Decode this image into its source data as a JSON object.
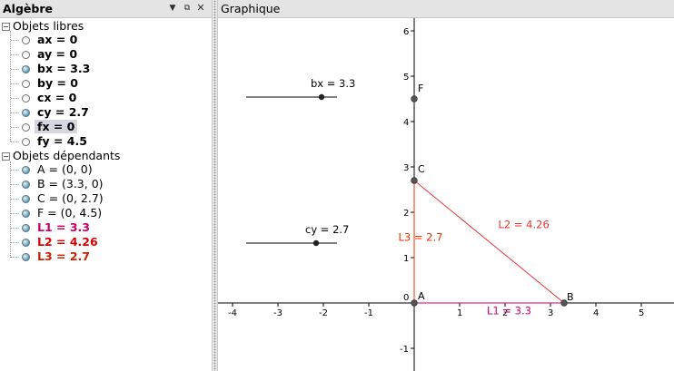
{
  "algebra": {
    "title": "Algèbre",
    "header_icons": [
      "arrow-down-icon",
      "restore-icon",
      "close-icon"
    ],
    "free_group": {
      "label": "Objets libres",
      "items": [
        {
          "text": "ax = 0",
          "visible": false,
          "color": "#000000",
          "selected": false
        },
        {
          "text": "ay = 0",
          "visible": false,
          "color": "#000000",
          "selected": false
        },
        {
          "text": "bx = 3.3",
          "visible": true,
          "color": "#000000",
          "selected": false
        },
        {
          "text": "by = 0",
          "visible": false,
          "color": "#000000",
          "selected": false
        },
        {
          "text": "cx = 0",
          "visible": false,
          "color": "#000000",
          "selected": false
        },
        {
          "text": "cy = 2.7",
          "visible": true,
          "color": "#000000",
          "selected": false
        },
        {
          "text": "fx = 0",
          "visible": false,
          "color": "#000000",
          "selected": true
        },
        {
          "text": "fy = 4.5",
          "visible": false,
          "color": "#000000",
          "selected": false
        }
      ]
    },
    "dependent_group": {
      "label": "Objets dépendants",
      "items": [
        {
          "text": "A = (0, 0)",
          "visible": true,
          "color": "#000000",
          "bold": false
        },
        {
          "text": "B = (3.3, 0)",
          "visible": true,
          "color": "#000000",
          "bold": false
        },
        {
          "text": "C = (0, 2.7)",
          "visible": true,
          "color": "#000000",
          "bold": false
        },
        {
          "text": "F = (0, 4.5)",
          "visible": true,
          "color": "#000000",
          "bold": false
        },
        {
          "text": "L1 = 3.3",
          "visible": true,
          "color": "#cc0066",
          "bold": true
        },
        {
          "text": "L2 = 4.26",
          "visible": true,
          "color": "#dd0000",
          "bold": true
        },
        {
          "text": "L3 = 2.7",
          "visible": true,
          "color": "#cc2200",
          "bold": true
        }
      ]
    }
  },
  "graphics": {
    "title": "Graphique",
    "x_ticks": [
      "-4",
      "-3",
      "-2",
      "-1",
      "0",
      "1",
      "2",
      "3",
      "4",
      "5"
    ],
    "y_ticks": [
      "-1",
      "1",
      "2",
      "3",
      "4",
      "5",
      "6"
    ],
    "sliders": [
      {
        "label": "bx = 3.3",
        "value": 3.3,
        "min": -5,
        "max": 5
      },
      {
        "label": "cy = 2.7",
        "value": 2.7,
        "min": -5,
        "max": 5
      }
    ],
    "points": [
      {
        "name": "A",
        "x": 0,
        "y": 0
      },
      {
        "name": "B",
        "x": 3.3,
        "y": 0
      },
      {
        "name": "C",
        "x": 0,
        "y": 2.7
      },
      {
        "name": "F",
        "x": 0,
        "y": 4.5
      }
    ],
    "segments": [
      {
        "name": "L1",
        "from": "A",
        "to": "B",
        "label": "L1 = 3.3",
        "color": "#cc0066"
      },
      {
        "name": "L2",
        "from": "B",
        "to": "C",
        "label": "L2 = 4.26",
        "color": "#ee3333"
      },
      {
        "name": "L3",
        "from": "A",
        "to": "C",
        "label": "L3 = 2.7",
        "color": "#ee3300"
      }
    ]
  }
}
